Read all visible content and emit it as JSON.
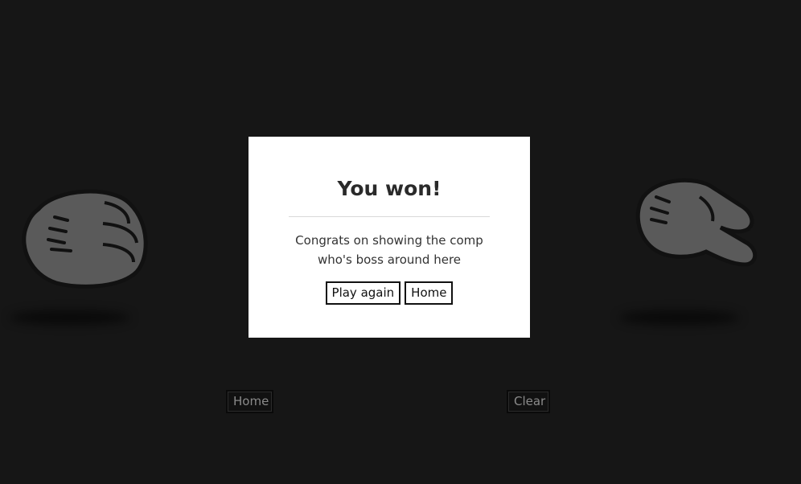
{
  "player": {
    "hand_icon": "rock-hand-icon"
  },
  "computer": {
    "hand_icon": "scissors-hand-icon"
  },
  "controls": {
    "home_label": "Home",
    "clear_label": "Clear"
  },
  "modal": {
    "title": "You won!",
    "message": "Congrats on showing the comp who's boss around here",
    "play_again_label": "Play again",
    "home_label": "Home"
  },
  "colors": {
    "background": "#161616",
    "hand_fill": "#5a5a5a",
    "hand_outline": "#111111",
    "modal_bg": "#ffffff"
  }
}
